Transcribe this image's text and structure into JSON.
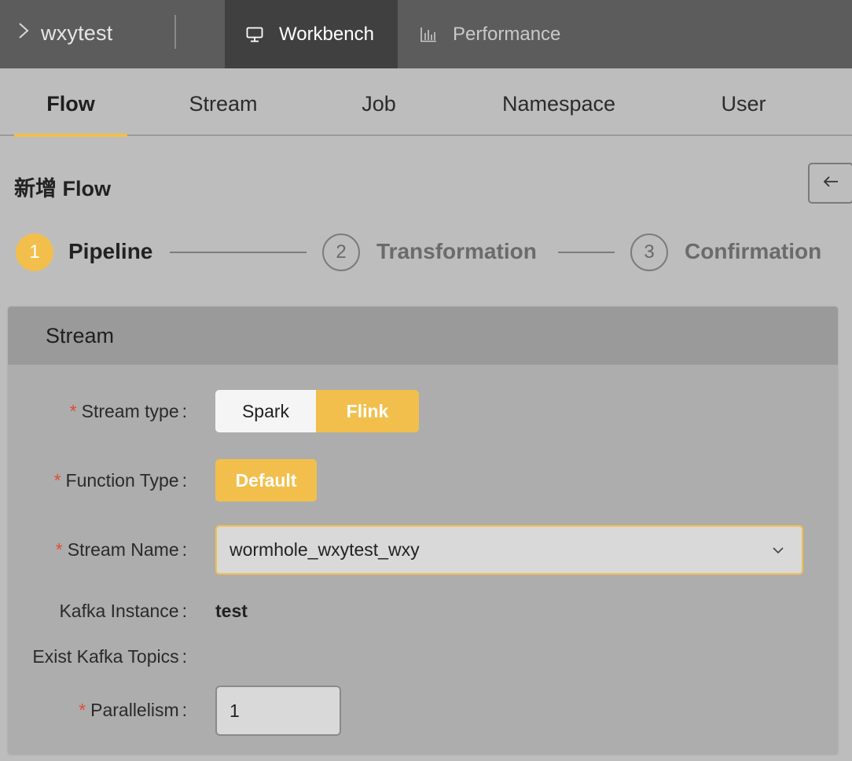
{
  "topbar": {
    "project_name": "wxytest",
    "nav": [
      {
        "label": "Workbench",
        "icon": "monitor-icon",
        "active": true
      },
      {
        "label": "Performance",
        "icon": "bar-chart-icon",
        "active": false
      }
    ]
  },
  "tabs": [
    {
      "label": "Flow",
      "active": true
    },
    {
      "label": "Stream",
      "active": false
    },
    {
      "label": "Job",
      "active": false
    },
    {
      "label": "Namespace",
      "active": false
    },
    {
      "label": "User",
      "active": false
    }
  ],
  "page": {
    "title": "新增 Flow",
    "back_icon": "arrow-left-icon"
  },
  "steps": [
    {
      "number": "1",
      "label": "Pipeline",
      "state": "active"
    },
    {
      "number": "2",
      "label": "Transformation",
      "state": "pending"
    },
    {
      "number": "3",
      "label": "Confirmation",
      "state": "pending"
    }
  ],
  "card": {
    "title": "Stream",
    "required_mark": "*",
    "colon": ":",
    "fields": {
      "stream_type": {
        "label": "Stream type",
        "options": [
          "Spark",
          "Flink"
        ],
        "selected": "Flink"
      },
      "function_type": {
        "label": "Function Type",
        "options": [
          "Default"
        ],
        "selected": "Default"
      },
      "stream_name": {
        "label": "Stream Name",
        "value": "wormhole_wxytest_wxy"
      },
      "kafka_instance": {
        "label": "Kafka Instance",
        "value": "test"
      },
      "exist_kafka_topics": {
        "label": "Exist Kafka Topics",
        "value": ""
      },
      "parallelism": {
        "label": "Parallelism",
        "value": "1"
      }
    }
  },
  "colors": {
    "accent": "#f2bf4c",
    "topbar": "#5c5c5c",
    "topbar_active": "#404040",
    "background": "#bdbdbd",
    "required": "#e04b3a"
  }
}
